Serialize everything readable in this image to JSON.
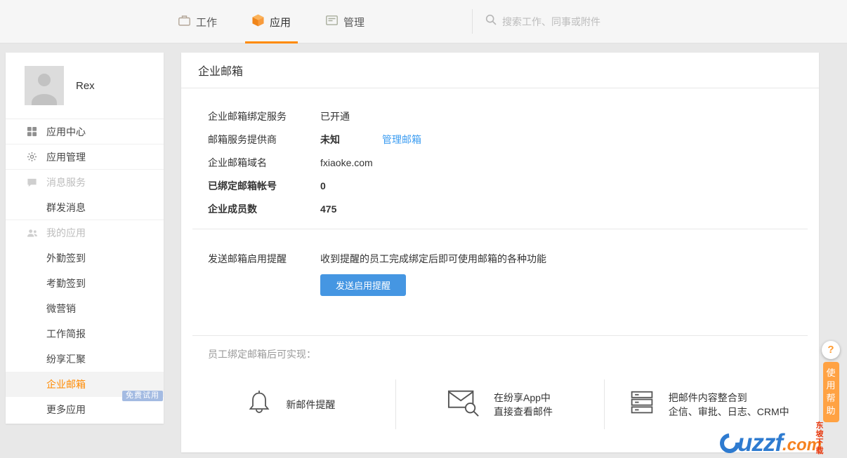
{
  "colors": {
    "accent_orange": "#ff8a00",
    "link_blue": "#3b9cf1",
    "button_blue": "#4596e2",
    "badge_blue": "#a4bbe2"
  },
  "topnav": {
    "tabs": [
      {
        "label": "工作"
      },
      {
        "label": "应用"
      },
      {
        "label": "管理"
      }
    ],
    "active_tab": "应用",
    "search_placeholder": "搜索工作、同事或附件"
  },
  "sidebar": {
    "user_name": "Rex",
    "items": [
      {
        "label": "应用中心"
      },
      {
        "label": "应用管理"
      },
      {
        "label": "消息服务"
      },
      {
        "label": "群发消息"
      },
      {
        "label": "我的应用"
      },
      {
        "label": "外勤签到"
      },
      {
        "label": "考勤签到"
      },
      {
        "label": "微营销"
      },
      {
        "label": "工作简报"
      },
      {
        "label": "纷享汇聚"
      },
      {
        "label": "企业邮箱"
      },
      {
        "label": "更多应用"
      }
    ],
    "active_item": "企业邮箱",
    "badge": "免费试用"
  },
  "main": {
    "title": "企业邮箱",
    "info_rows": [
      {
        "label": "企业邮箱绑定服务",
        "value": "已开通"
      },
      {
        "label": "邮箱服务提供商",
        "value": "未知",
        "link": "管理邮箱"
      },
      {
        "label": "企业邮箱域名",
        "value": "fxiaoke.com"
      },
      {
        "label": "已绑定邮箱帐号",
        "value": "0"
      },
      {
        "label": "企业成员数",
        "value": "475"
      }
    ],
    "reminder": {
      "label": "发送邮箱启用提醒",
      "description": "收到提醒的员工完成绑定后即可使用邮箱的各种功能",
      "button_label": "发送启用提醒"
    },
    "features": {
      "heading": "员工绑定邮箱后可实现：",
      "items": [
        {
          "icon": "bell-icon",
          "line1": "新邮件提醒",
          "line2": ""
        },
        {
          "icon": "mail-search-icon",
          "line1": "在纷享App中",
          "line2": "直接查看邮件"
        },
        {
          "icon": "server-stack-icon",
          "line1": "把邮件内容整合到",
          "line2": "企信、审批、日志、CRM中"
        }
      ]
    }
  },
  "help_widget": {
    "question": "?",
    "label": "使用帮助"
  },
  "watermark": {
    "brand": "uzzf",
    "tld": ".com",
    "caption": "东坡下载"
  }
}
